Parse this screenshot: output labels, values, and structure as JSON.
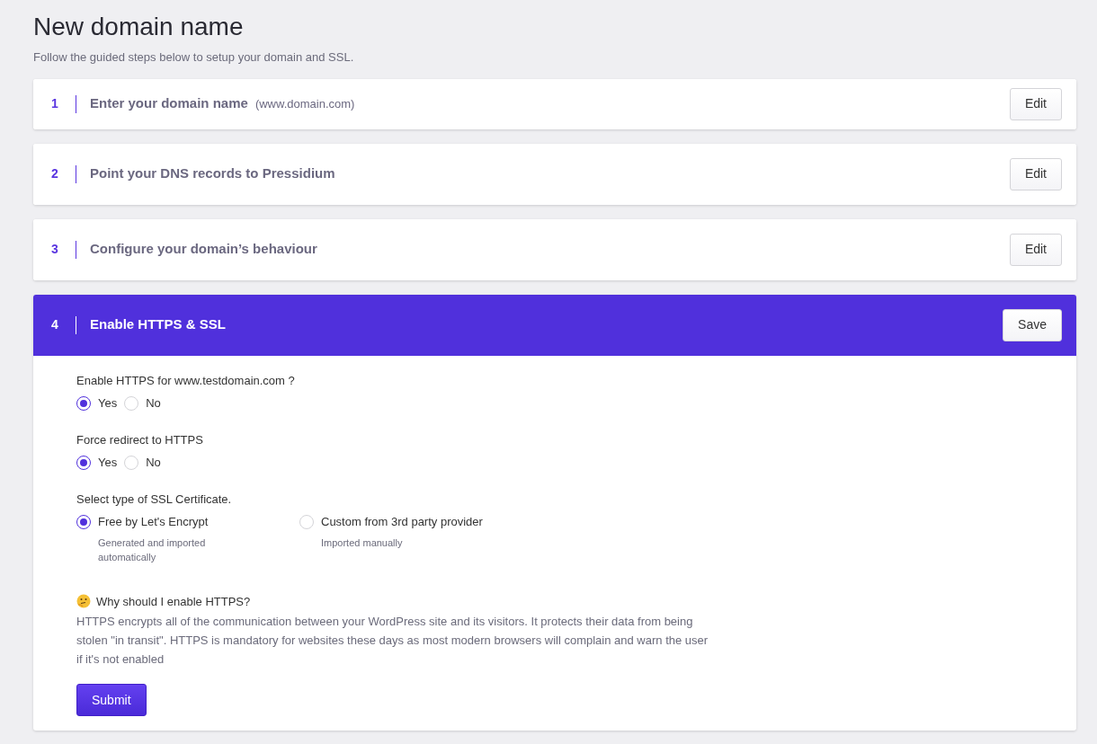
{
  "page": {
    "title": "New domain name",
    "subtitle": "Follow the guided steps below to setup your domain and SSL."
  },
  "steps": [
    {
      "number": "1",
      "title": "Enter your domain name",
      "hint": "(www.domain.com)",
      "active": false,
      "button": "Edit"
    },
    {
      "number": "2",
      "title": "Point your DNS records to Pressidium",
      "active": false,
      "button": "Edit"
    },
    {
      "number": "3",
      "title": "Configure your domain’s behaviour",
      "active": false,
      "button": "Edit"
    },
    {
      "number": "4",
      "title": "Enable HTTPS & SSL",
      "active": true,
      "button": "Save"
    }
  ],
  "form": {
    "groups": [
      {
        "label": "Enable HTTPS for www.testdomain.com ?",
        "options": [
          {
            "label": "Yes",
            "selected": true
          },
          {
            "label": "No",
            "selected": false
          }
        ]
      },
      {
        "label": "Force redirect to HTTPS",
        "options": [
          {
            "label": "Yes",
            "selected": true
          },
          {
            "label": "No",
            "selected": false
          }
        ]
      },
      {
        "label": "Select type of SSL Certificate.",
        "options": [
          {
            "label": "Free by Let's Encrypt",
            "description": "Generated and imported automatically",
            "selected": true
          },
          {
            "label": "Custom from 3rd party provider",
            "description": "Imported manually",
            "selected": false
          }
        ]
      }
    ],
    "info": {
      "heading": "Why should I enable HTTPS?",
      "text": "HTTPS encrypts all of the communication between your WordPress site and its visitors. It protects their data from being stolen \"in transit\". HTTPS is mandatory for websites these days as most modern browsers will complain and warn the user if it's not enabled"
    },
    "submit": "Submit"
  }
}
